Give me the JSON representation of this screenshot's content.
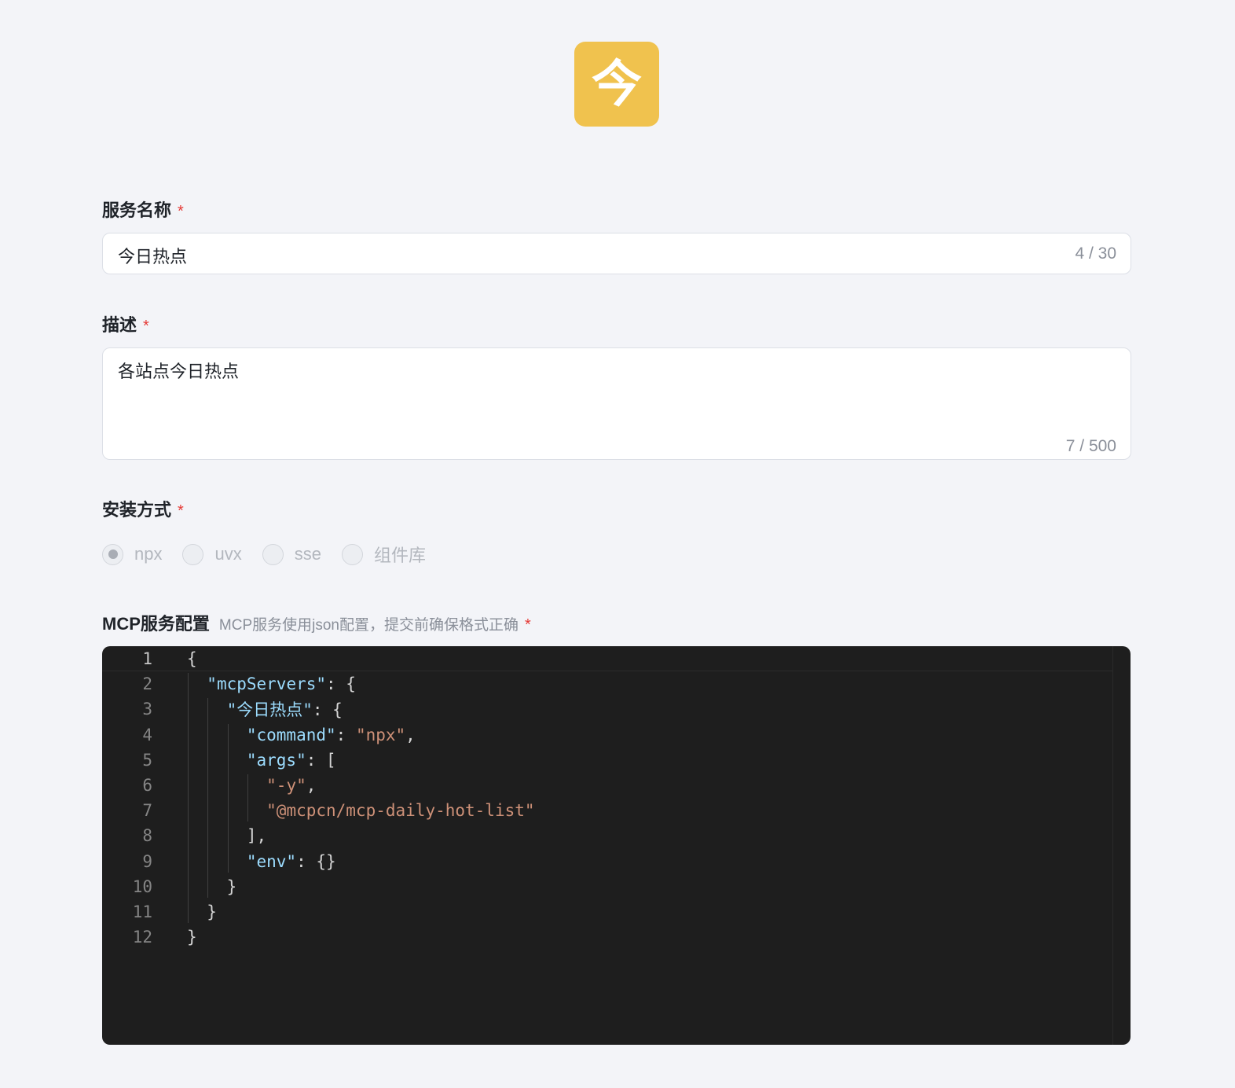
{
  "logo": {
    "char": "今",
    "bg": "#f0c24e"
  },
  "service_name": {
    "label": "服务名称",
    "required": "*",
    "value": "今日热点",
    "count": "4 / 30"
  },
  "description": {
    "label": "描述",
    "required": "*",
    "value": "各站点今日热点",
    "count": "7 / 500"
  },
  "install": {
    "label": "安装方式",
    "required": "*",
    "options": [
      "npx",
      "uvx",
      "sse",
      "组件库"
    ],
    "selected": "npx"
  },
  "config": {
    "label": "MCP服务配置",
    "hint": "MCP服务使用json配置，提交前确保格式正确",
    "required": "*",
    "line_numbers": [
      "1",
      "2",
      "3",
      "4",
      "5",
      "6",
      "7",
      "8",
      "9",
      "10",
      "11",
      "12"
    ],
    "lines": [
      [
        {
          "t": "p",
          "v": "{"
        }
      ],
      [
        {
          "t": "p",
          "v": "  "
        },
        {
          "t": "k",
          "v": "\"mcpServers\""
        },
        {
          "t": "p",
          "v": ": {"
        }
      ],
      [
        {
          "t": "p",
          "v": "    "
        },
        {
          "t": "k",
          "v": "\"今日热点\""
        },
        {
          "t": "p",
          "v": ": {"
        }
      ],
      [
        {
          "t": "p",
          "v": "      "
        },
        {
          "t": "k",
          "v": "\"command\""
        },
        {
          "t": "p",
          "v": ": "
        },
        {
          "t": "s",
          "v": "\"npx\""
        },
        {
          "t": "p",
          "v": ","
        }
      ],
      [
        {
          "t": "p",
          "v": "      "
        },
        {
          "t": "k",
          "v": "\"args\""
        },
        {
          "t": "p",
          "v": ": ["
        }
      ],
      [
        {
          "t": "p",
          "v": "        "
        },
        {
          "t": "s",
          "v": "\"-y\""
        },
        {
          "t": "p",
          "v": ","
        }
      ],
      [
        {
          "t": "p",
          "v": "        "
        },
        {
          "t": "s",
          "v": "\"@mcpcn/mcp-daily-hot-list\""
        }
      ],
      [
        {
          "t": "p",
          "v": "      ],"
        }
      ],
      [
        {
          "t": "p",
          "v": "      "
        },
        {
          "t": "k",
          "v": "\"env\""
        },
        {
          "t": "p",
          "v": ": {}"
        }
      ],
      [
        {
          "t": "p",
          "v": "    }"
        }
      ],
      [
        {
          "t": "p",
          "v": "  }"
        }
      ],
      [
        {
          "t": "p",
          "v": "}"
        }
      ]
    ]
  }
}
